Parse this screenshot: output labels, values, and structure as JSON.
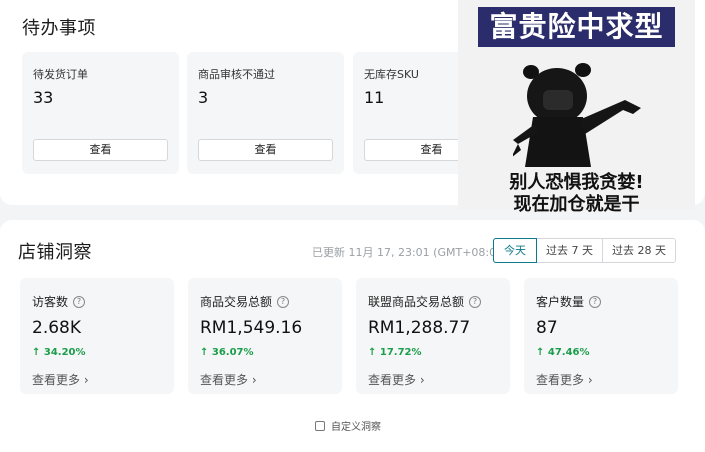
{
  "todo": {
    "title": "待办事项",
    "cards": [
      {
        "label": "待发货订单",
        "count": "33",
        "button": "查看"
      },
      {
        "label": "商品审核不通过",
        "count": "3",
        "button": "查看"
      },
      {
        "label": "无库存SKU",
        "count": "11",
        "button": "查看"
      }
    ]
  },
  "meme": {
    "caption_top": "富贵险中求型",
    "caption_bottom_line1": "别人恐惧我贪婪!",
    "caption_bottom_line2": "现在加仓就是干"
  },
  "insight": {
    "title": "店铺洞察",
    "updated": "已更新 11月 17, 23:01 (GMT+08:00)",
    "ranges": [
      "今天",
      "过去 7 天",
      "过去 28 天"
    ],
    "active_range": "今天",
    "metrics": [
      {
        "label": "访客数",
        "value": "2.68K",
        "change": "34.20%",
        "more": "查看更多"
      },
      {
        "label": "商品交易总额",
        "value": "RM1,549.16",
        "change": "36.07%",
        "more": "查看更多"
      },
      {
        "label": "联盟商品交易总额",
        "value": "RM1,288.77",
        "change": "17.72%",
        "more": "查看更多"
      },
      {
        "label": "客户数量",
        "value": "87",
        "change": "47.46%",
        "more": "查看更多"
      }
    ],
    "customize_label": "自定义洞察"
  },
  "colors": {
    "accent": "#0b7a8a",
    "positive": "#1a9e4b",
    "card_bg": "#f5f6f7"
  },
  "icons": {
    "help": "question-circle-icon",
    "up": "arrow-up-icon",
    "chevron": "chevron-right-icon",
    "edit": "edit-icon"
  }
}
